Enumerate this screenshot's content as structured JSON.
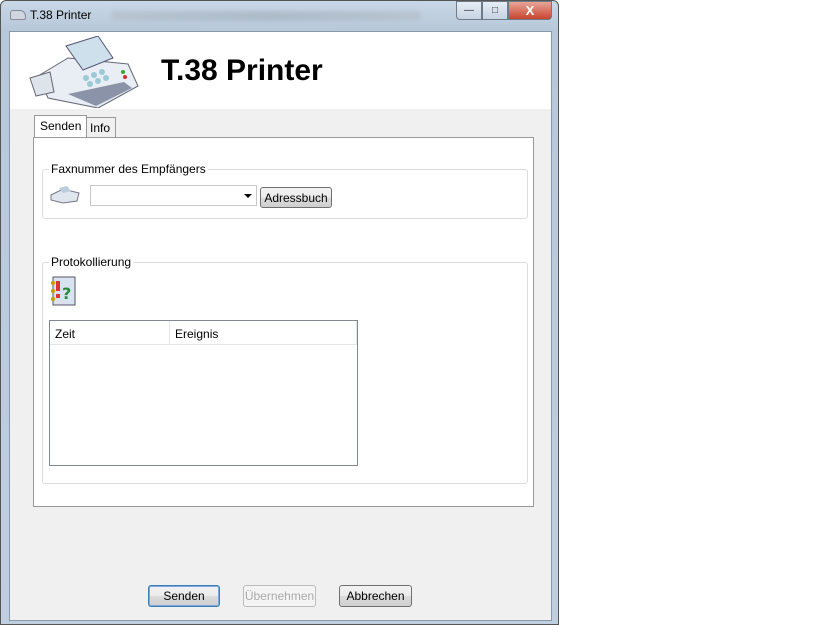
{
  "window": {
    "title": "T.38 Printer",
    "controls": {
      "minimize": "—",
      "maximize": "□",
      "close": "X"
    }
  },
  "header": {
    "title": "T.38 Printer"
  },
  "tabs": [
    {
      "label": "Senden",
      "selected": true
    },
    {
      "label": "Info",
      "selected": false
    }
  ],
  "recipient": {
    "group_label": "Faxnummer des Empfängers",
    "fax_number": "",
    "addressbook_label": "Adressbuch"
  },
  "log": {
    "group_label": "Protokollierung",
    "columns": [
      "Zeit",
      "Ereignis"
    ],
    "rows": []
  },
  "footer": {
    "send_label": "Senden",
    "apply_label": "Übernehmen",
    "cancel_label": "Abbrechen"
  }
}
